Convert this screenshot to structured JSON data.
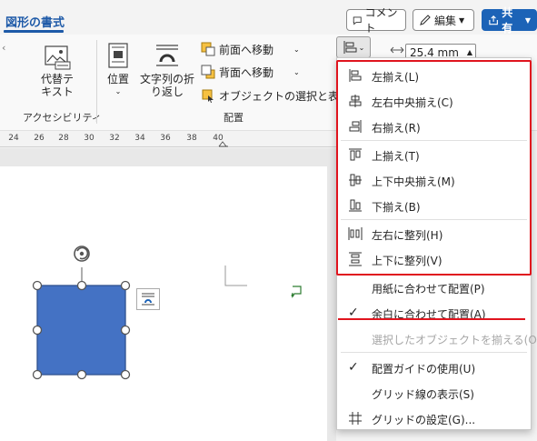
{
  "topbar": {
    "tab_label": "図形の書式",
    "comment_label": "コメント",
    "edit_label": "編集",
    "share_label": "共有"
  },
  "ribbon": {
    "alt_text_label_1": "代替テ",
    "alt_text_label_2": "キスト",
    "accessibility_group": "アクセシビリティ",
    "position_label": "位置",
    "wrap_text_label_1": "文字列の折",
    "wrap_text_label_2": "り返し",
    "bring_forward_label": "前面へ移動",
    "send_backward_label": "背面へ移動",
    "selection_pane_label": "オブジェクトの選択と表示",
    "arrange_group": "配置",
    "width_value": "25.4 mm"
  },
  "ruler": {
    "ticks": [
      "24",
      "26",
      "28",
      "30",
      "32",
      "34",
      "36",
      "38",
      "40"
    ]
  },
  "menu": {
    "items": [
      {
        "label": "左揃え(L)",
        "icon": "align-left-icon",
        "enabled": true
      },
      {
        "label": "左右中央揃え(C)",
        "icon": "align-center-icon",
        "enabled": true
      },
      {
        "label": "右揃え(R)",
        "icon": "align-right-icon",
        "enabled": true
      },
      {
        "label": "上揃え(T)",
        "icon": "align-top-icon",
        "enabled": true
      },
      {
        "label": "上下中央揃え(M)",
        "icon": "align-middle-icon",
        "enabled": true
      },
      {
        "label": "下揃え(B)",
        "icon": "align-bottom-icon",
        "enabled": true
      },
      {
        "label": "左右に整列(H)",
        "icon": "distribute-horizontal-icon",
        "enabled": true
      },
      {
        "label": "上下に整列(V)",
        "icon": "distribute-vertical-icon",
        "enabled": true
      },
      {
        "label": "用紙に合わせて配置(P)",
        "icon": "",
        "enabled": true
      },
      {
        "label": "余白に合わせて配置(A)",
        "icon": "check-icon",
        "enabled": true
      },
      {
        "label": "選択したオブジェクトを揃える(O)",
        "icon": "",
        "enabled": false
      },
      {
        "label": "配置ガイドの使用(U)",
        "icon": "check-icon",
        "enabled": true
      },
      {
        "label": "グリッド線の表示(S)",
        "icon": "",
        "enabled": true
      },
      {
        "label": "グリッドの設定(G)...",
        "icon": "grid-icon",
        "enabled": true
      }
    ]
  },
  "colors": {
    "accent": "#1e5aa8",
    "highlight": "#e0141e",
    "shape_fill": "#4472c4"
  }
}
